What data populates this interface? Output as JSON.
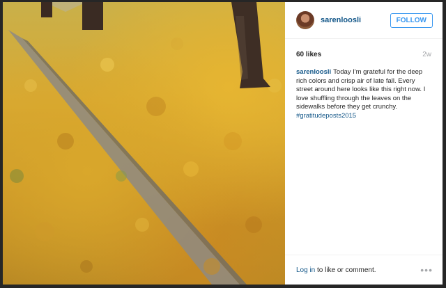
{
  "post": {
    "username": "sarenloosli",
    "follow_label": "FOLLOW",
    "likes": "60 likes",
    "age": "2w",
    "caption_user": "sarenloosli",
    "caption_text": "Today I'm grateful for the deep rich colors and crisp air of late fall. Every street around here looks like this right now. I love shuffling through the leaves on the sidewalks before they get crunchy.",
    "hashtag": "#gratitudeposts2015"
  },
  "footer": {
    "login_link": "Log in",
    "login_suffix": " to like or comment.",
    "more_icon": "more-options-icon"
  },
  "colors": {
    "link": "#125688",
    "button": "#3897f0",
    "muted": "#a5a7aa"
  }
}
